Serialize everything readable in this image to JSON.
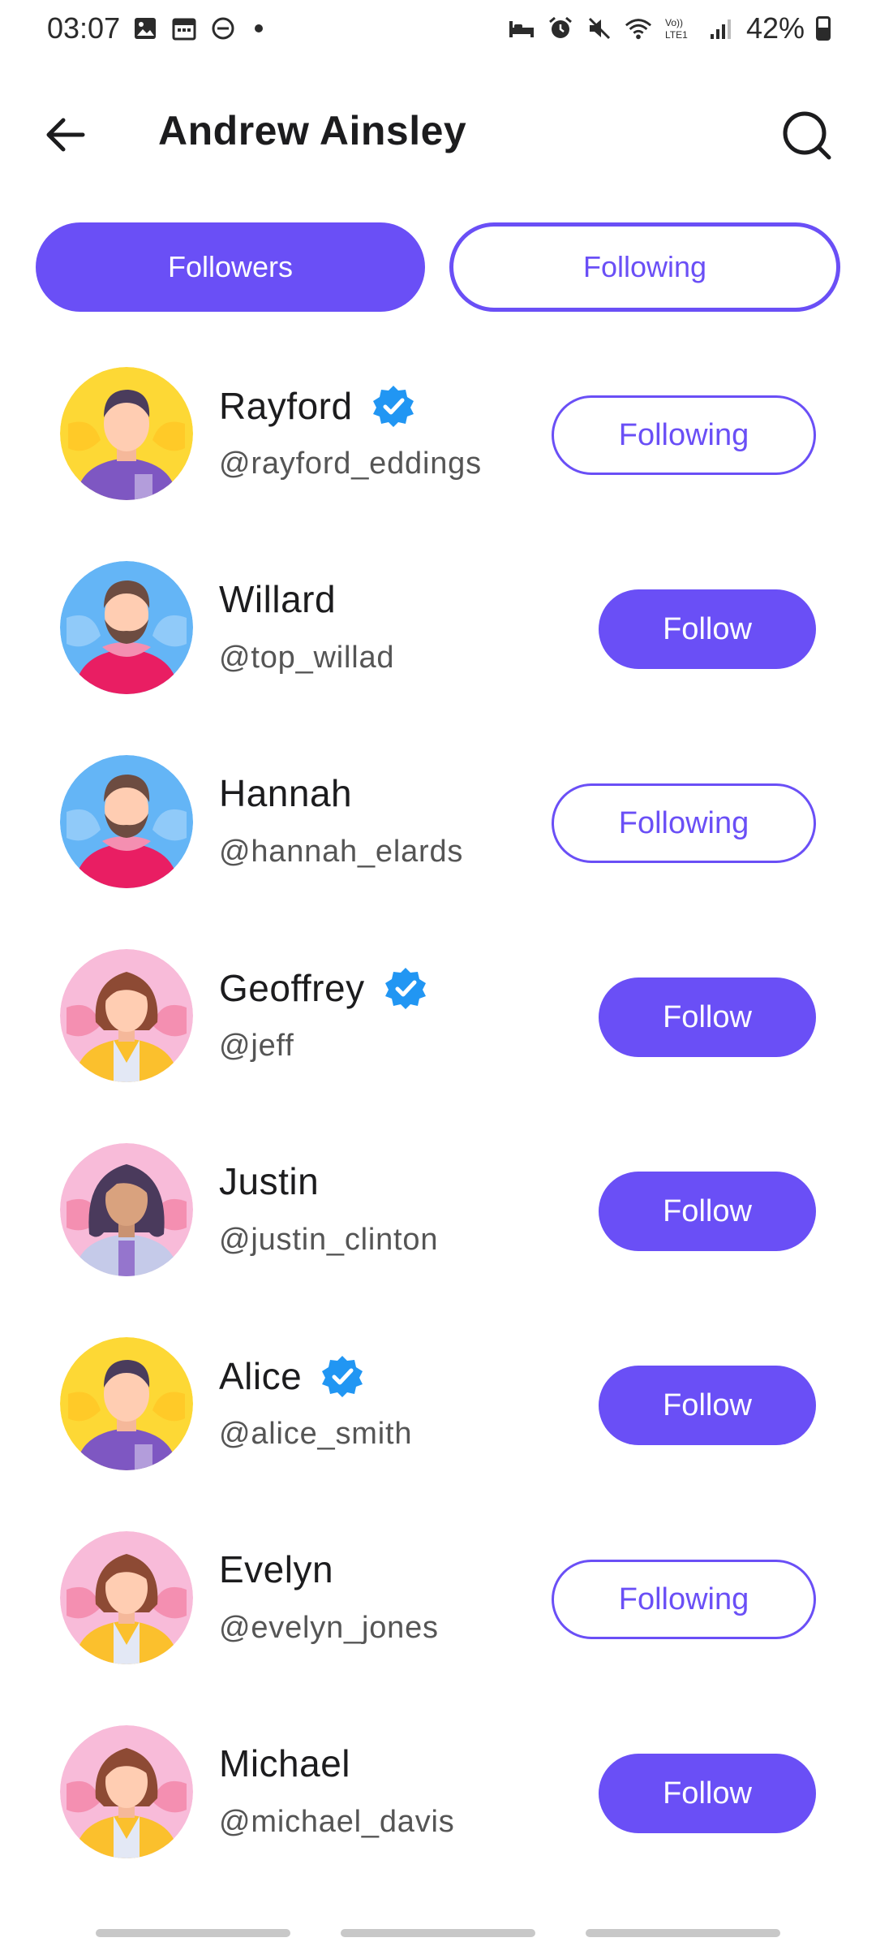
{
  "status_bar": {
    "time": "03:07",
    "battery": "42%",
    "icons": [
      "gallery-icon",
      "calendar-icon",
      "dnd-icon",
      "dot",
      "sleep-icon",
      "alarm-icon",
      "mute-icon",
      "wifi-icon",
      "volte-icon",
      "signal-icon",
      "battery-icon"
    ]
  },
  "header": {
    "title": "Andrew Ainsley",
    "back_icon": "back-arrow-icon",
    "search_icon": "search-icon"
  },
  "tabs": [
    {
      "label": "Followers",
      "active": true
    },
    {
      "label": "Following",
      "active": false
    }
  ],
  "users": [
    {
      "name": "Rayford",
      "handle": "@rayford_eddings",
      "verified": true,
      "action": "Following",
      "avatar": "man-yellow"
    },
    {
      "name": "Willard",
      "handle": "@top_willad",
      "verified": false,
      "action": "Follow",
      "avatar": "man-beard-blue"
    },
    {
      "name": "Hannah",
      "handle": "@hannah_elards",
      "verified": false,
      "action": "Following",
      "avatar": "man-beard-blue"
    },
    {
      "name": "Geoffrey",
      "handle": "@jeff",
      "verified": true,
      "action": "Follow",
      "avatar": "woman-pink"
    },
    {
      "name": "Justin",
      "handle": "@justin_clinton",
      "verified": false,
      "action": "Follow",
      "avatar": "woman-curly-pink"
    },
    {
      "name": "Alice",
      "handle": "@alice_smith",
      "verified": true,
      "action": "Follow",
      "avatar": "man-yellow"
    },
    {
      "name": "Evelyn",
      "handle": "@evelyn_jones",
      "verified": false,
      "action": "Following",
      "avatar": "woman-pink"
    },
    {
      "name": "Michael",
      "handle": "@michael_davis",
      "verified": false,
      "action": "Follow",
      "avatar": "woman-pink"
    }
  ],
  "colors": {
    "accent": "#6a4ff6",
    "verified": "#2196f3"
  }
}
